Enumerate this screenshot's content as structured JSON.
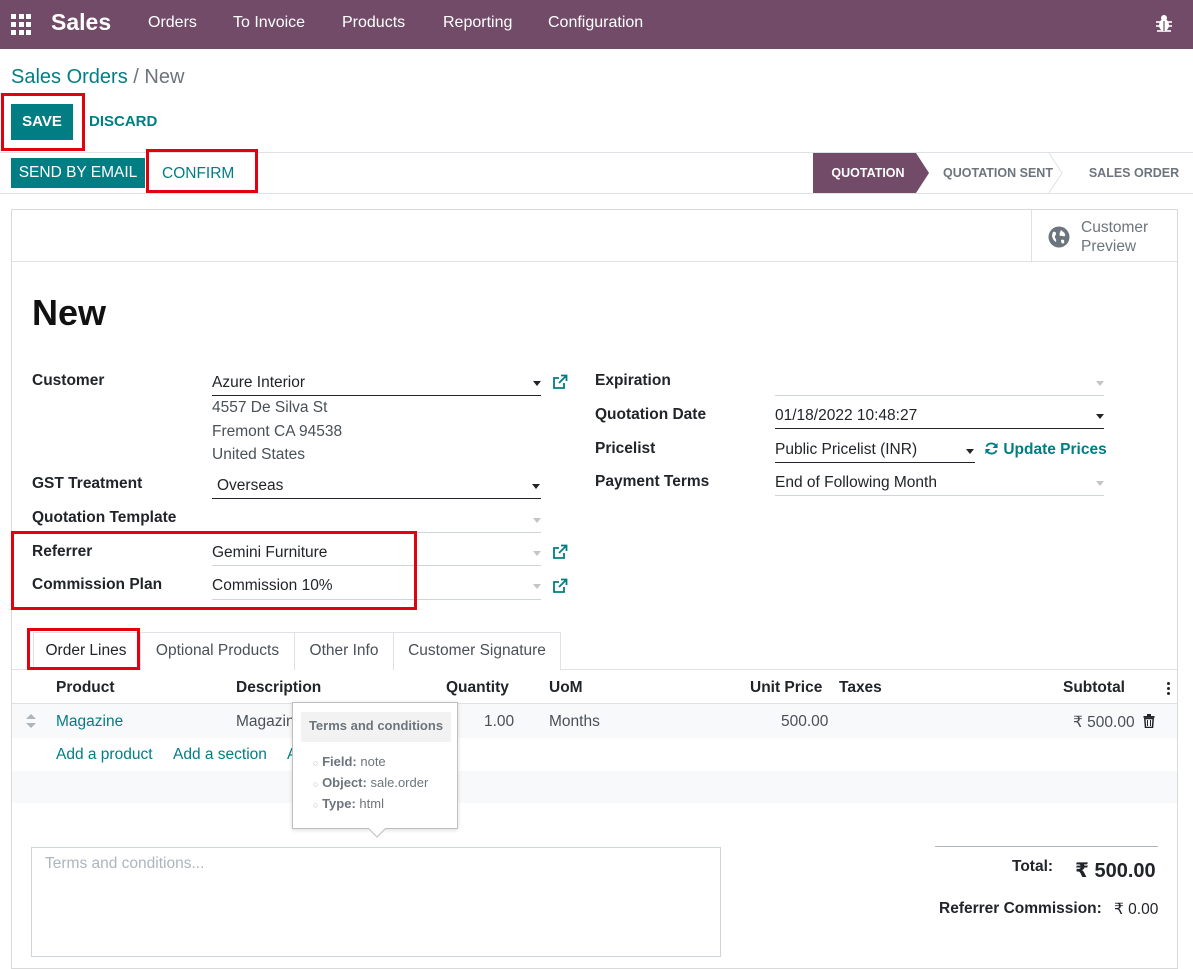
{
  "nav": {
    "app_name": "Sales",
    "menu": [
      "Orders",
      "To Invoice",
      "Products",
      "Reporting",
      "Configuration"
    ]
  },
  "breadcrumb": {
    "parent": "Sales Orders",
    "separator": "/",
    "current": "New"
  },
  "actions": {
    "save": "SAVE",
    "discard": "DISCARD",
    "send_email": "SEND BY EMAIL",
    "confirm": "CONFIRM"
  },
  "stages": [
    "QUOTATION",
    "QUOTATION SENT",
    "SALES ORDER"
  ],
  "customer_preview": {
    "line1": "Customer",
    "line2": "Preview"
  },
  "record_title": "New",
  "left_fields": {
    "customer_label": "Customer",
    "customer_value": "Azure Interior",
    "address_line1": "4557 De Silva St",
    "address_line2": "Fremont CA 94538",
    "address_line3": "United States",
    "gst_label": "GST Treatment",
    "gst_value": "Overseas",
    "template_label": "Quotation Template",
    "template_value": "",
    "referrer_label": "Referrer",
    "referrer_value": "Gemini Furniture",
    "commission_label": "Commission Plan",
    "commission_value": "Commission 10%"
  },
  "right_fields": {
    "expiration_label": "Expiration",
    "expiration_value": "",
    "qdate_label": "Quotation Date",
    "qdate_value": "01/18/2022 10:48:27",
    "pricelist_label": "Pricelist",
    "pricelist_value": "Public Pricelist (INR)",
    "update_prices": "Update Prices",
    "terms_label": "Payment Terms",
    "terms_value": "End of Following Month"
  },
  "tabs": [
    "Order Lines",
    "Optional Products",
    "Other Info",
    "Customer Signature"
  ],
  "columns": [
    "Product",
    "Description",
    "Quantity",
    "UoM",
    "Unit Price",
    "Taxes",
    "Subtotal"
  ],
  "order_line": {
    "product": "Magazine",
    "description": "Magazin",
    "quantity": "1.00",
    "uom": "Months",
    "unit_price": "500.00",
    "subtotal": "₹ 500.00"
  },
  "line_actions": {
    "add_product": "Add a product",
    "add_section": "Add a section",
    "add_note": "A"
  },
  "tooltip": {
    "title": "Terms and conditions",
    "field_label": "Field:",
    "field_value": "note",
    "object_label": "Object:",
    "object_value": "sale.order",
    "type_label": "Type:",
    "type_value": "html"
  },
  "terms_placeholder": "Terms and conditions...",
  "totals": {
    "total_label": "Total:",
    "total_value": "₹ 500.00",
    "commission_label": "Referrer Commission:",
    "commission_value": "₹ 0.00"
  },
  "colors": {
    "brand": "#714b67",
    "primary": "#017e84",
    "highlight": "#e3000f"
  }
}
